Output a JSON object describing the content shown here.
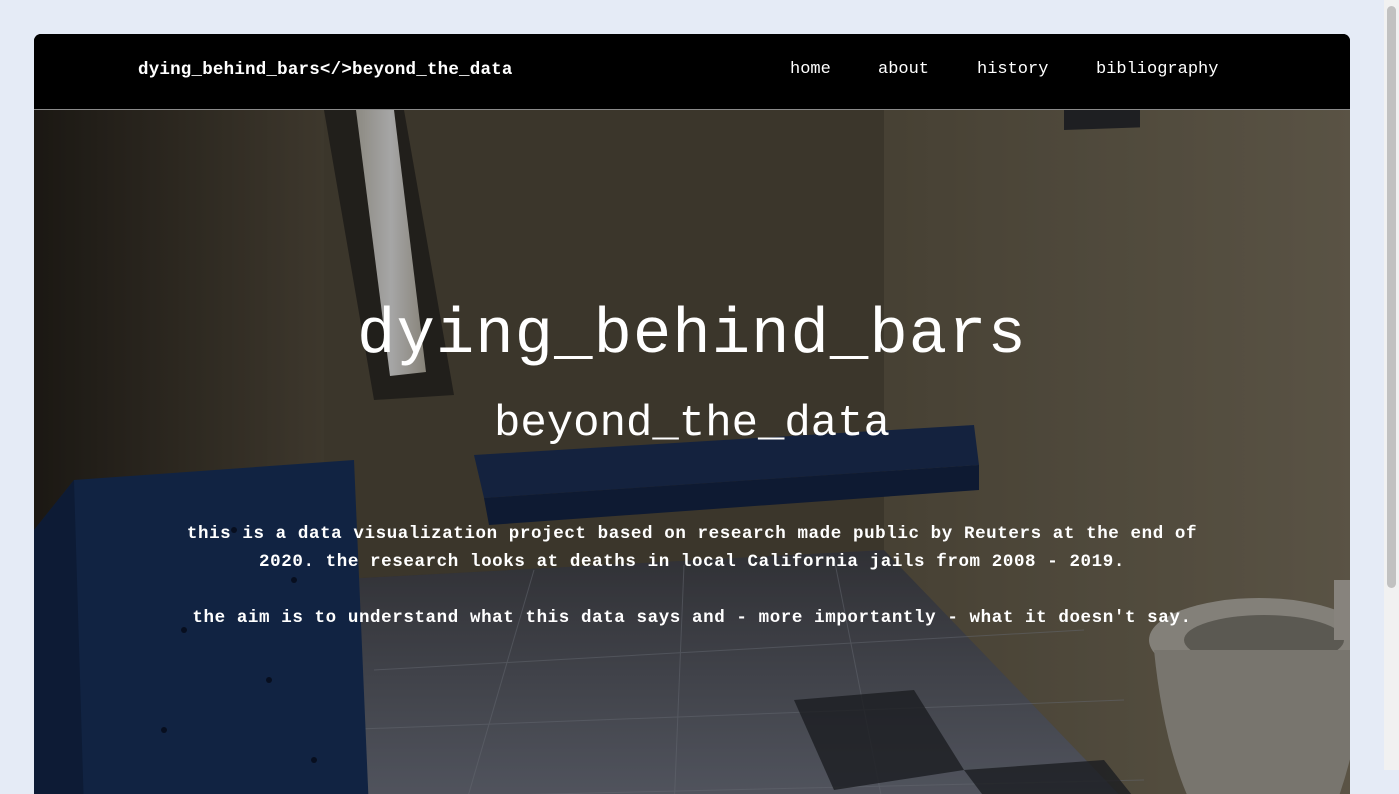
{
  "navbar": {
    "brand": "dying_behind_bars</>beyond_the_data",
    "links": [
      {
        "label": "home"
      },
      {
        "label": "about"
      },
      {
        "label": "history"
      },
      {
        "label": "bibliography"
      }
    ]
  },
  "hero": {
    "background_image": "jail-cell-photo",
    "title": "dying_behind_bars",
    "subtitle": "beyond_the_data",
    "paragraph_1": "this is a data visualization project based on research made public by Reuters at the end of 2020. the research looks at deaths in local California jails from 2008 - 2019.",
    "paragraph_2": "the aim is to understand what this data says and - more importantly - what it doesn't say."
  },
  "colors": {
    "page_background": "#e5ebf6",
    "navbar_background": "#000000",
    "text": "#ffffff"
  }
}
